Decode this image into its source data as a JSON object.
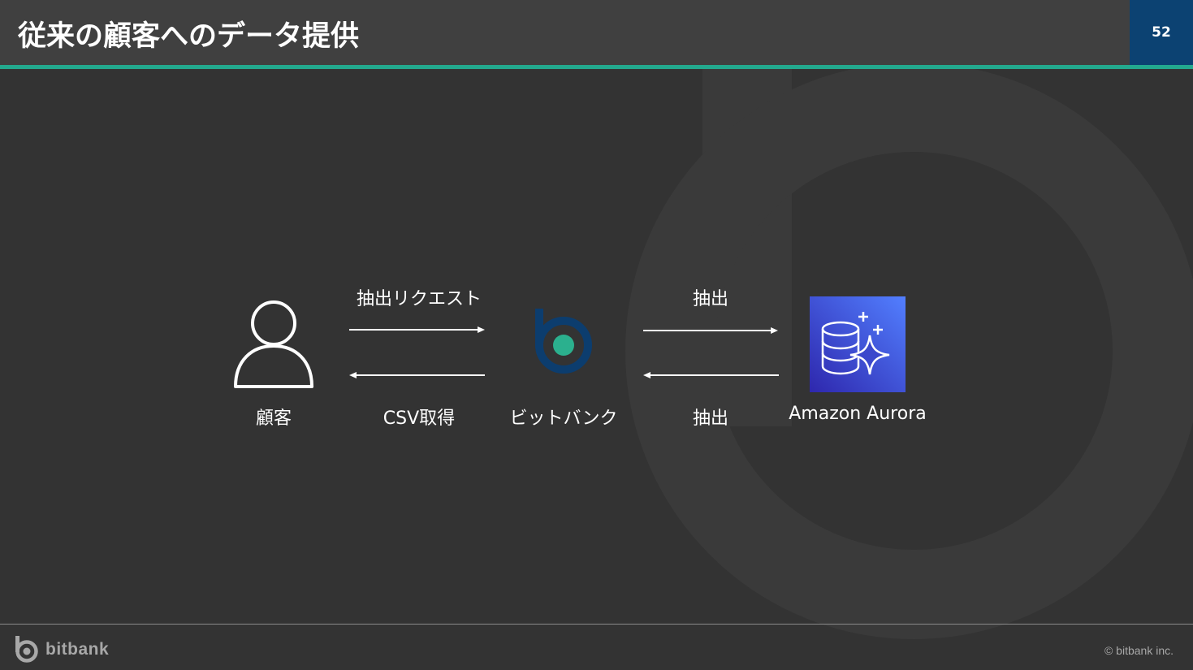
{
  "slide": {
    "title": "従来の顧客へのデータ提供",
    "page_number": "52"
  },
  "diagram": {
    "customer_label": "顧客",
    "bitbank_label": "ビットバンク",
    "aurora_label": "Amazon Aurora",
    "request_label": "抽出リクエスト",
    "csv_label": "CSV取得",
    "extract_top_label": "抽出",
    "extract_bottom_label": "抽出",
    "icons": {
      "customer": "person-icon",
      "bitbank": "bitbank-logo-icon",
      "aurora": "aurora-database-icon"
    }
  },
  "footer": {
    "brand": "bitbank",
    "copyright": "© bitbank inc."
  },
  "colors": {
    "background": "#333333",
    "header": "#404040",
    "accent": "#23a98e",
    "page_badge": "#0c4272",
    "aurora": "#3b48cc"
  }
}
